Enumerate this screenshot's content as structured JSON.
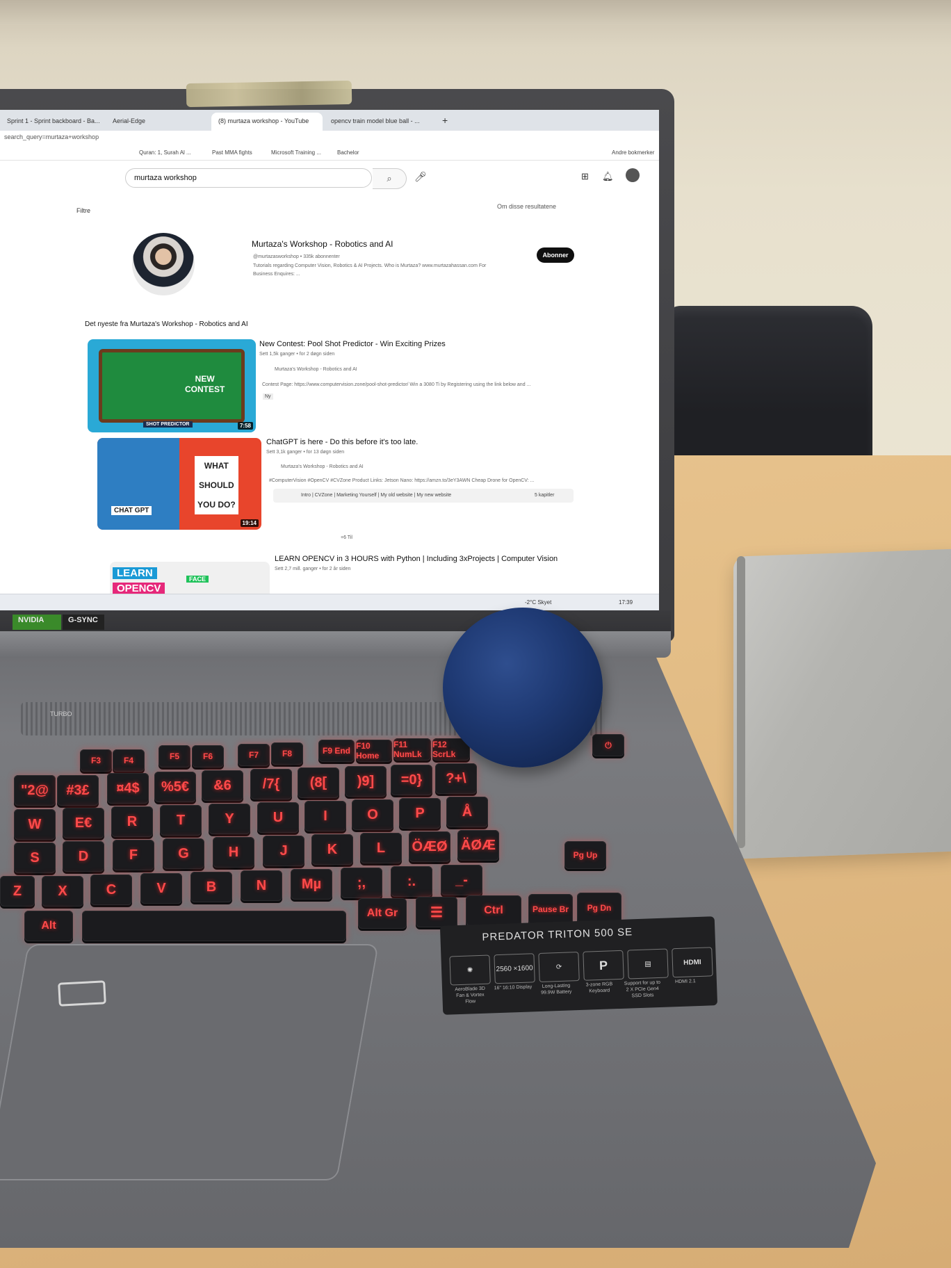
{
  "browser": {
    "tabs": [
      {
        "label": "Sprint 1 - Sprint backboard - Ba..."
      },
      {
        "label": "Aerial-Edge"
      },
      {
        "label": "(8) murtaza workshop - YouTube",
        "active": true
      },
      {
        "label": "opencv train model blue ball - ..."
      }
    ],
    "new_tab": "+",
    "address": "search_query=murtaza+workshop",
    "bookmarks": [
      "Quran: 1, Surah Al ...",
      "Past MMA fights",
      "Microsoft Training ...",
      "Bachelor"
    ],
    "other_bookmarks": "Andre bokmerker"
  },
  "youtube": {
    "search_value": "murtaza workshop",
    "filter": "Filtre",
    "about_results": "Om disse resultatene",
    "channel": {
      "name": "Murtaza's Workshop - Robotics and AI",
      "handle_subs": "@murtazasworkshop • 335k abonnenter",
      "desc_line1": "Tutorials regarding Computer Vision, Robotics & AI Projects. Who is Murtaza? www.murtazahassan.com For",
      "desc_line2": "Business Enquires: ...",
      "subscribe": "Abonner"
    },
    "section_title": "Det nyeste fra Murtaza's Workshop - Robotics and AI",
    "videos": [
      {
        "title": "New Contest: Pool Shot Predictor - Win Exciting Prizes",
        "meta": "Sett 1,5k ganger • for 2 døgn siden",
        "channel": "Murtaza's Workshop - Robotics and AI",
        "desc": "Contest Page: https://www.computervision.zone/pool-shot-predictor/ Win a 3080 Ti by Registering using the link below and ...",
        "badge": "Ny",
        "duration": "7:58",
        "thumb_text1": "NEW",
        "thumb_text2": "CONTEST",
        "thumb_text3": "SHOT PREDICTOR"
      },
      {
        "title": "ChatGPT is here - Do this before it's too late.",
        "meta": "Sett 3,1k ganger • for 13 døgn siden",
        "channel": "Murtaza's Workshop - Robotics and AI",
        "desc": "#ComputerVision #OpenCV #CVZone Product Links: Jetson Nano: https://amzn.to/3eY3AWN Cheap Drone for OpenCV: ...",
        "chapters": "Intro | CVZone | Marketing Yourself | My old website | My new website",
        "chapters_count": "5 kapitler",
        "duration": "19:14",
        "thumb_text1": "WHAT",
        "thumb_text2": "SHOULD",
        "thumb_text3": "YOU DO?",
        "thumb_text4": "CHAT GPT"
      }
    ],
    "more": "+6 Til",
    "video3": {
      "title": "LEARN OPENCV in 3 HOURS with Python | Including 3xProjects | Computer Vision",
      "meta": "Sett 2,7 mill. ganger • for 2 år siden",
      "thumb_text1": "LEARN",
      "thumb_text2": "OPENCV",
      "thumb_text3": "FACE"
    }
  },
  "taskbar": {
    "weather": "-2°C Skyet",
    "time": "17:39"
  },
  "laptop": {
    "badge_nvidia": "NVIDIA",
    "badge_gsync": "G-SYNC",
    "turbo": "TURBO",
    "sticker_title": "PREDATOR TRITON 500 SE",
    "sticker_icons": [
      "",
      "2560 ×1600",
      "",
      "P",
      "",
      "HDMI"
    ],
    "sticker_labels": [
      "AeroBlade 3D Fan & Vortex Flow",
      "16\" 16:10 Display",
      "Long-Lasting 99.9W Battery",
      "3-zone RGB Keyboard",
      "Support for up to 2 X PCIe Gen4 SSD Slots",
      "HDMI 2.1"
    ],
    "keys": {
      "row_f": [
        "F3",
        "F4",
        "F5",
        "F6",
        "F7",
        "F8",
        "F9 End",
        "F10 Home",
        "F11 NumLk",
        "F12 ScrLk"
      ],
      "row_num": [
        "\"2@",
        "#3£",
        "¤4$",
        "%5€",
        "&6",
        "/7{",
        "(8[",
        ")9]",
        "=0}",
        "?+\\"
      ],
      "row_q": [
        "W",
        "E€",
        "R",
        "T",
        "Y",
        "U",
        "I",
        "O",
        "P",
        "Å"
      ],
      "row_a": [
        "S",
        "D",
        "F",
        "G",
        "H",
        "J",
        "K",
        "L",
        "ÖÆØ",
        "ÄØÆ"
      ],
      "row_z": [
        "Z",
        "X",
        "C",
        "V",
        "B",
        "N",
        "Mµ",
        ";,",
        ":.",
        "_-"
      ],
      "row_bottom": [
        "Alt",
        "Alt Gr",
        "☰",
        "Ctrl",
        "Pause Br",
        "Pg Dn"
      ],
      "side": [
        "⏻",
        "Pg Up"
      ]
    }
  }
}
